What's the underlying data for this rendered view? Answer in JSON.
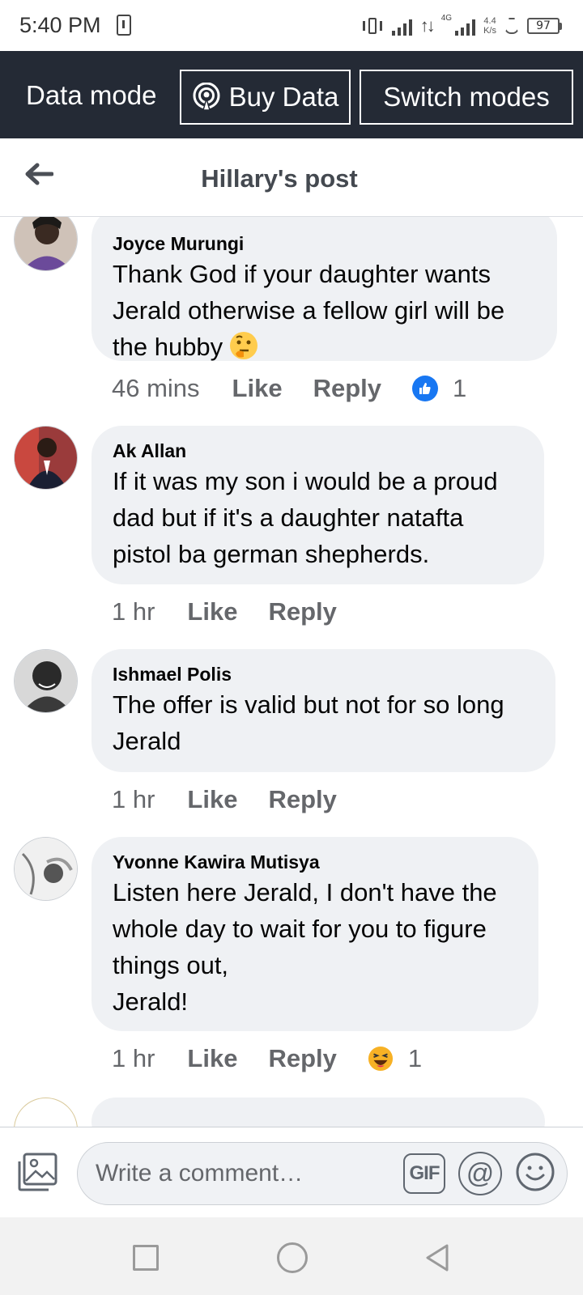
{
  "status_bar": {
    "time": "5:40 PM",
    "network_type": "4G",
    "speed_value": "4.4",
    "speed_unit": "K/s",
    "battery": "97"
  },
  "data_bar": {
    "mode_label": "Data mode",
    "buy_label": "Buy Data",
    "switch_label": "Switch modes"
  },
  "header": {
    "title": "Hillary's post"
  },
  "comments": [
    {
      "author": "Joyce Murungi",
      "text": "Thank God if your daughter wants Jerald otherwise a fellow girl will be the hubby",
      "text_emoji": "thinking-face",
      "time": "46 mins",
      "like_label": "Like",
      "reply_label": "Reply",
      "reaction": "like",
      "reaction_count": "1"
    },
    {
      "author": "Ak Allan",
      "text": "If it was my son i would be a proud dad but if it's a daughter natafta pistol ba german shepherds.",
      "time": "1 hr",
      "like_label": "Like",
      "reply_label": "Reply"
    },
    {
      "author": "Ishmael Polis",
      "text": "The offer is valid but not for so long Jerald",
      "time": "1 hr",
      "like_label": "Like",
      "reply_label": "Reply"
    },
    {
      "author": "Yvonne Kawira Mutisya",
      "text": "Listen here Jerald, I don't have the whole day to wait for you to figure things out,\n Jerald!",
      "time": "1 hr",
      "like_label": "Like",
      "reply_label": "Reply",
      "reaction": "haha",
      "reaction_count": "1"
    }
  ],
  "composer": {
    "placeholder": "Write a comment…",
    "gif_label": "GIF",
    "mention_label": "@"
  },
  "colors": {
    "data_bar_bg": "#242a35",
    "bubble_bg": "#eff1f4",
    "like_blue": "#1877f2",
    "muted_text": "#65676b"
  }
}
